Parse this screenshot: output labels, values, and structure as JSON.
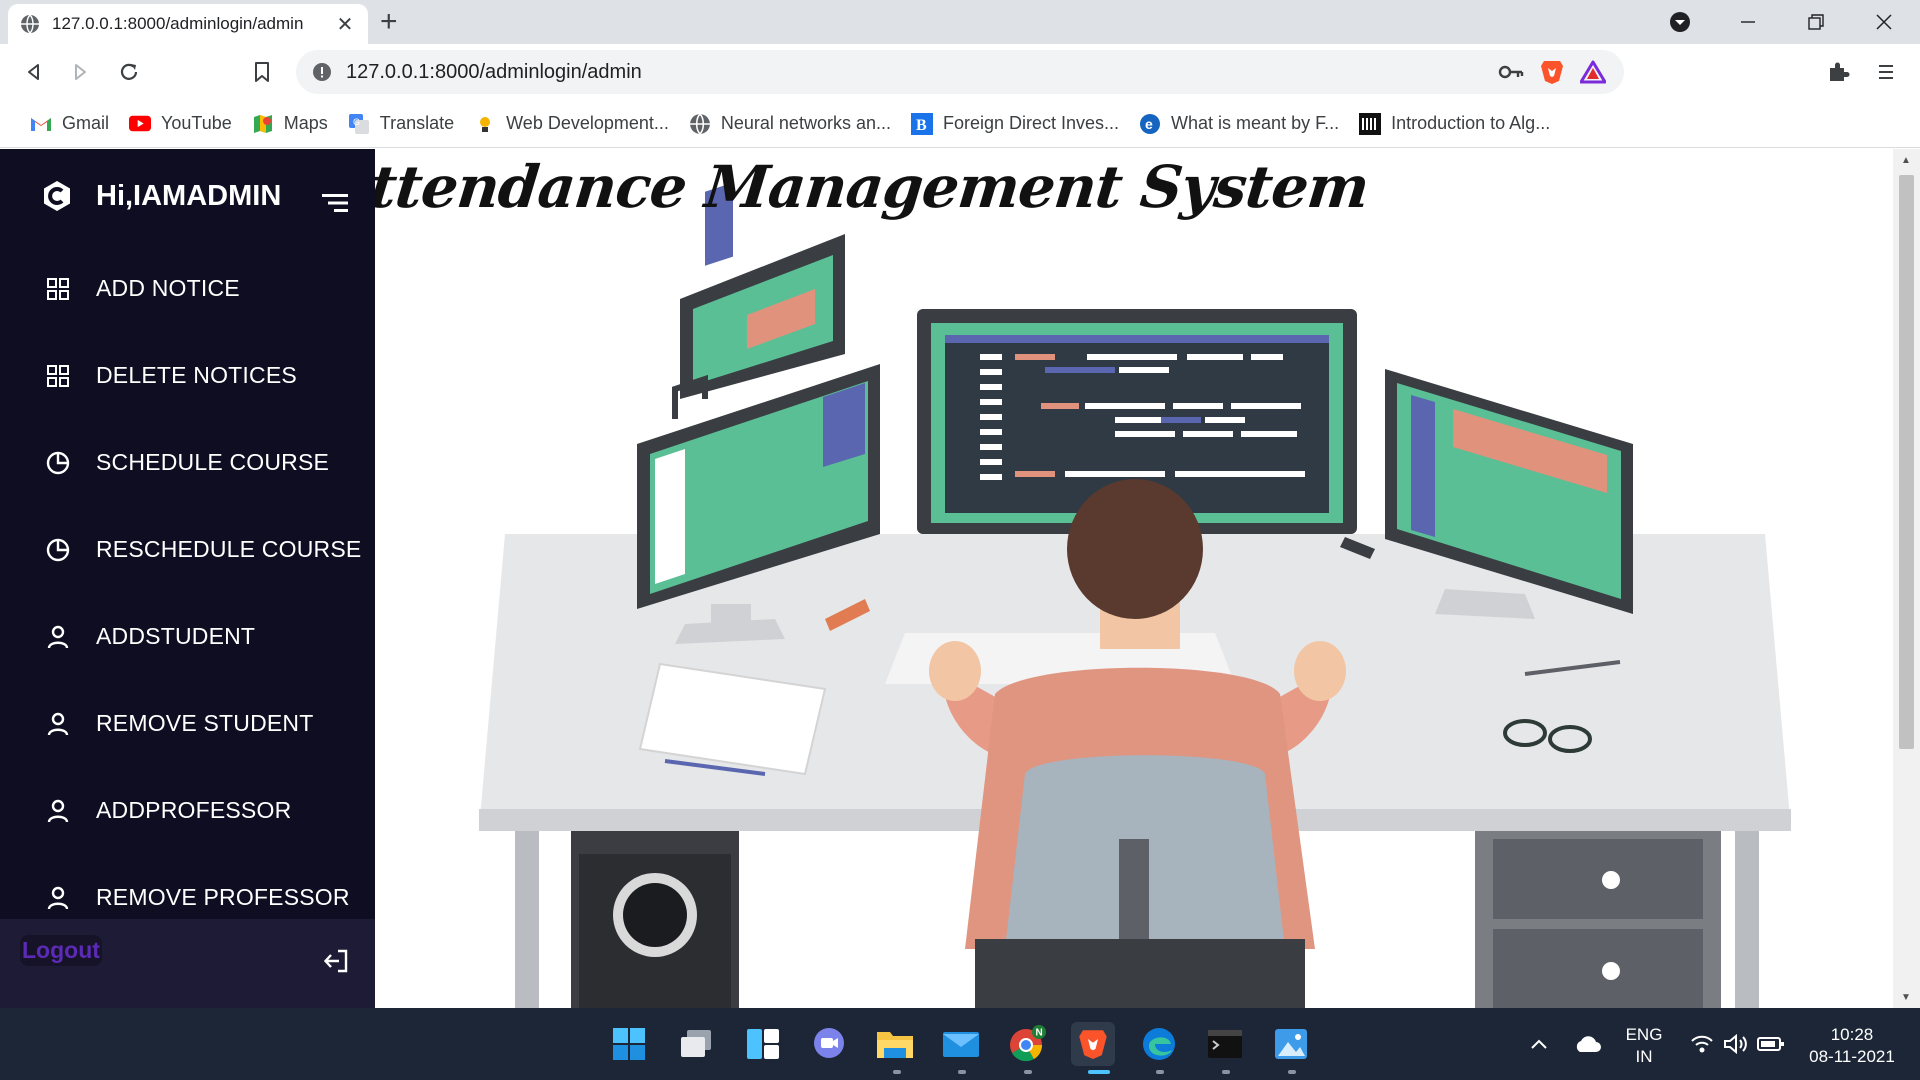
{
  "browser": {
    "tab_title": "127.0.0.1:8000/adminlogin/admin",
    "url": "127.0.0.1:8000/adminlogin/admin",
    "bookmarks": [
      {
        "label": "Gmail",
        "icon": "gmail-icon"
      },
      {
        "label": "YouTube",
        "icon": "youtube-icon"
      },
      {
        "label": "Maps",
        "icon": "maps-icon"
      },
      {
        "label": "Translate",
        "icon": "translate-icon"
      },
      {
        "label": "Web Development...",
        "icon": "bulb-icon"
      },
      {
        "label": "Neural networks an...",
        "icon": "globe-icon"
      },
      {
        "label": "Foreign Direct Inves...",
        "icon": "b-icon"
      },
      {
        "label": "What is meant by F...",
        "icon": "e-icon"
      },
      {
        "label": "Introduction to Alg...",
        "icon": "book-icon"
      }
    ]
  },
  "sidebar": {
    "brand": "Hi,IAMADMIN",
    "items": [
      {
        "label": "ADD NOTICE",
        "icon": "grid-icon"
      },
      {
        "label": "DELETE NOTICES",
        "icon": "grid-icon"
      },
      {
        "label": "SCHEDULE COURSE",
        "icon": "pie-icon"
      },
      {
        "label": "RESCHEDULE COURSE",
        "icon": "pie-icon"
      },
      {
        "label": "ADDSTUDENT",
        "icon": "user-icon"
      },
      {
        "label": "REMOVE STUDENT",
        "icon": "user-icon"
      },
      {
        "label": "ADDPROFESSOR",
        "icon": "user-icon"
      },
      {
        "label": "REMOVE PROFESSOR",
        "icon": "user-icon"
      }
    ],
    "logout": "Logout"
  },
  "main": {
    "heading": "Attendance Management System"
  },
  "taskbar": {
    "lang_top": "ENG",
    "lang_bottom": "IN",
    "time": "10:28",
    "date": "08-11-2021",
    "chrome_badge": "N"
  },
  "colors": {
    "sidebar_bg": "#0f0d21",
    "logout_bar": "#1e1b37",
    "logout_text": "#5b2bb5",
    "taskbar_bg": "#1c2636"
  }
}
